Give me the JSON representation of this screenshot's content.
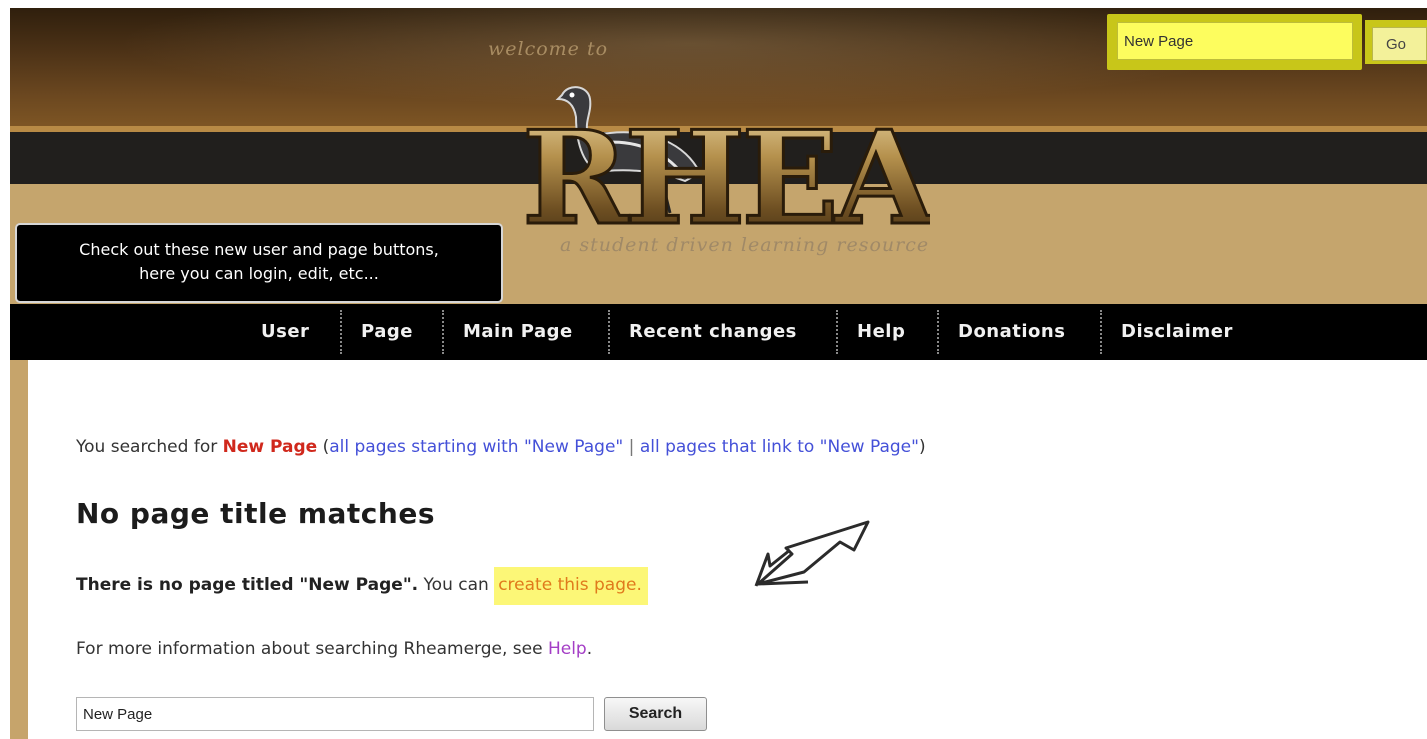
{
  "header": {
    "welcome_text": "welcome to",
    "logo_text": "RHEA",
    "tagline": "a student driven learning resource",
    "search": {
      "value": "New Page",
      "go_label": "Go"
    },
    "highlight_color": "#c8c619"
  },
  "tooltip": {
    "line1": "Check out these new user and page buttons,",
    "line2": "here you can login, edit, etc..."
  },
  "nav": {
    "items": [
      {
        "label": "User"
      },
      {
        "label": "Page"
      },
      {
        "label": "Main Page"
      },
      {
        "label": "Recent changes"
      },
      {
        "label": "Help"
      },
      {
        "label": "Donations"
      },
      {
        "label": "Disclaimer"
      }
    ]
  },
  "content": {
    "searched_prefix": "You searched for",
    "search_term": "New Page",
    "paren_open": "(",
    "link_starting": "all pages starting with \"New Page\"",
    "pipe": "|",
    "link_linking": "all pages that link to \"New Page\"",
    "paren_close": ")",
    "heading": "No page title matches",
    "no_page_bold": "There is no page titled \"New Page\".",
    "you_can": "You can",
    "create_link": "create this page.",
    "more_info_prefix": "For more information about searching Rheamerge, see",
    "help_link": "Help",
    "more_info_suffix": ".",
    "search_value": "New Page",
    "search_button": "Search"
  },
  "colors": {
    "header_brown": "#4b3116",
    "header_tan": "#c5a56d",
    "nav_bg": "#000000",
    "term_red": "#d0281c",
    "link_blue": "#4450d8",
    "create_orange": "#e07a1c",
    "help_purple": "#a43ec6",
    "highlight_yellow": "#fcf777"
  },
  "icons": {
    "logo": "rhea-bird-logo",
    "annotation": "arrow-pointer-icon"
  }
}
